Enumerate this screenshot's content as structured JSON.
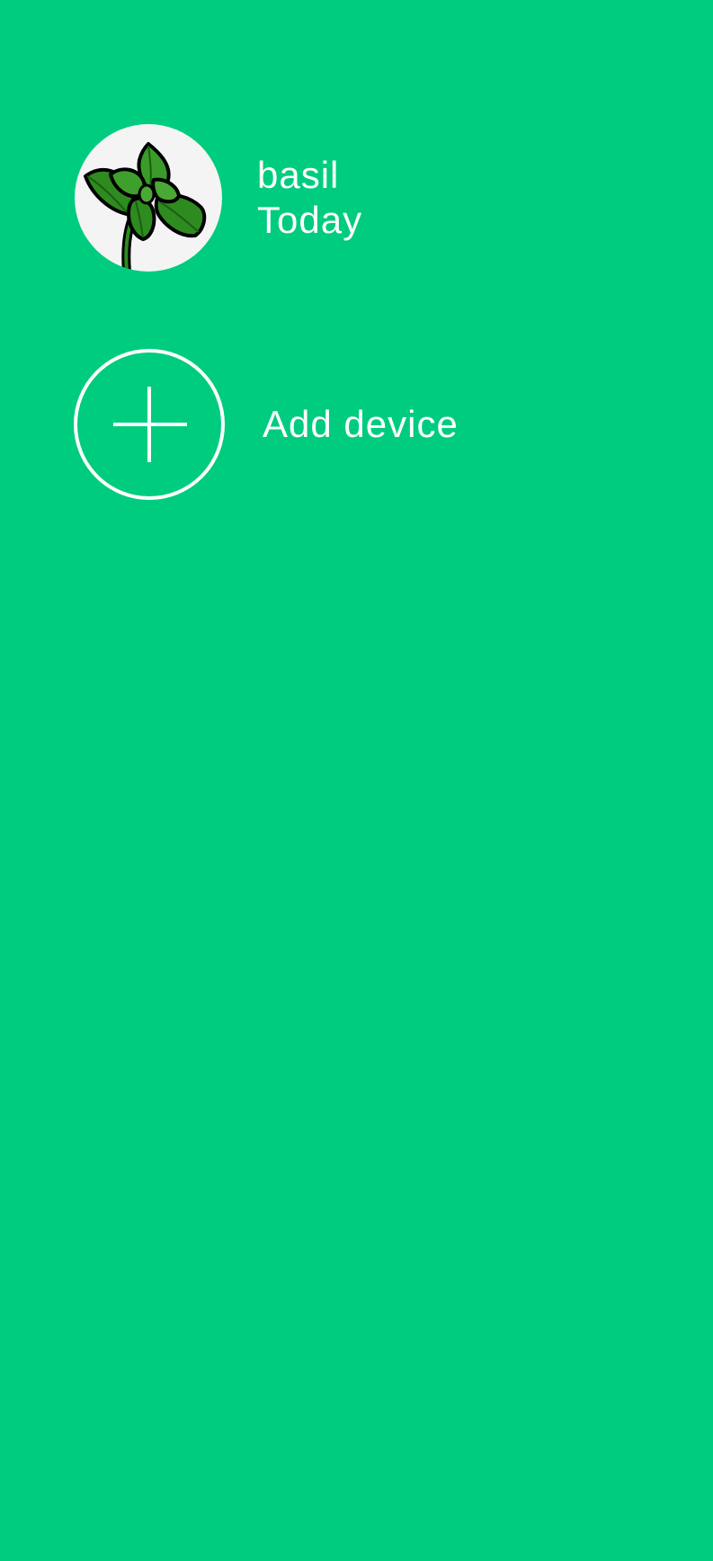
{
  "theme": {
    "background": "#00cc7f",
    "text_color": "#ffffff",
    "leaf_color": "#2e8b1f",
    "leaf_outline": "#000000",
    "avatar_background": "#f4f4f4"
  },
  "devices": [
    {
      "name": "basil",
      "last_seen": "Today",
      "icon": "basil-plant-icon"
    }
  ],
  "add_device": {
    "label": "Add device",
    "icon": "plus-icon"
  }
}
